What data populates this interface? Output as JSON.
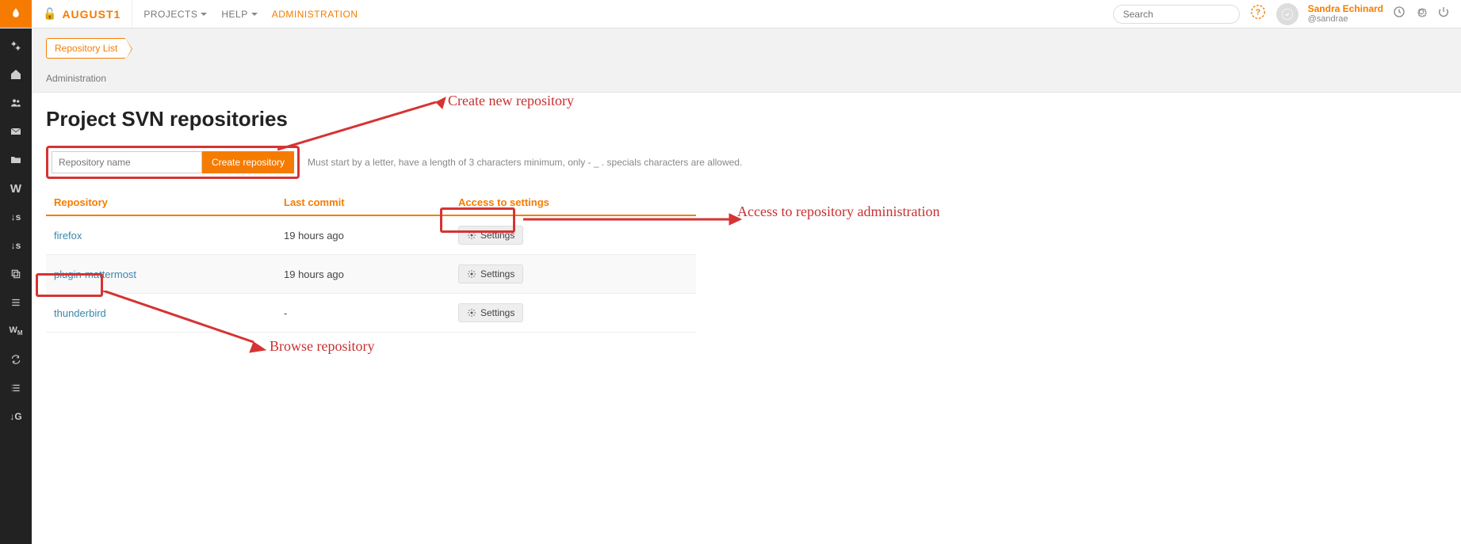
{
  "brand": "AUGUST1",
  "nav": {
    "projects": "PROJECTS",
    "help": "HELP",
    "administration": "ADMINISTRATION"
  },
  "search": {
    "placeholder": "Search"
  },
  "user": {
    "name": "Sandra Echinard",
    "handle": "@sandrae"
  },
  "breadcrumb": {
    "root": "Repository List",
    "sub": "Administration"
  },
  "page": {
    "title": "Project SVN repositories",
    "input_placeholder": "Repository name",
    "create_btn": "Create repository",
    "hint": "Must start by a letter, have a length of 3 characters minimum, only - _ . specials characters are allowed."
  },
  "table": {
    "col_repo": "Repository",
    "col_last": "Last commit",
    "col_access": "Access to settings",
    "settings_label": "Settings",
    "rows": [
      {
        "name": "firefox",
        "last": "19 hours ago"
      },
      {
        "name": "plugin-mattermost",
        "last": "19 hours ago"
      },
      {
        "name": "thunderbird",
        "last": "-"
      }
    ]
  },
  "annotations": {
    "create": "Create new repository",
    "access": "Access to repository administration",
    "browse": "Browse repository"
  }
}
